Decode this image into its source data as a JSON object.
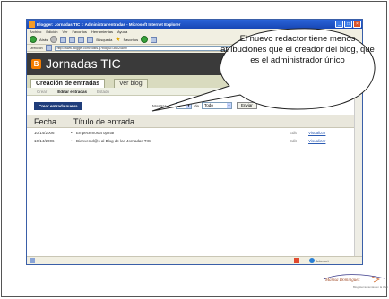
{
  "browser": {
    "window_title": "Blogger: Jornadas TIC :: Administrar entradas - Microsoft Internet Explorer",
    "menu": [
      "Archivo",
      "Edición",
      "Ver",
      "Favoritos",
      "Herramientas",
      "Ayuda"
    ],
    "toolbar": {
      "back": "Atrás",
      "search": "Búsqueda",
      "favorites": "Favoritos"
    },
    "address_label": "Dirección",
    "address_value": "http://www.blogger.com/posts.g?blogID=36024899",
    "status_zone": "Internet"
  },
  "blog": {
    "logo_letter": "B",
    "title": "Jornadas TIC",
    "tabs": {
      "active": "Creación de entradas",
      "inactive": "Ver blog"
    },
    "subtabs": [
      "Crear",
      "Editar entradas",
      "Estado"
    ],
    "new_post_button": "Crear entrada nueva",
    "filter": {
      "show_label": "Mostrar",
      "count_value": "5",
      "de_label": "de",
      "filter_value": "Todo",
      "send_button": "Enviar"
    },
    "columns": {
      "date": "Fecha",
      "title": "Título de entrada"
    },
    "posts": [
      {
        "date": "10/14/2006",
        "title": "Empecemos a opinar",
        "edit": "Edit",
        "view": "Visualizar"
      },
      {
        "date": "10/14/2006",
        "title": "Bienvenid@s al Blog de las Jornadas TIC",
        "edit": "Edit",
        "view": "Visualizar"
      }
    ]
  },
  "callout": {
    "text": "El nuevo redactor tiene menos atribuciones que el creador del blog, que es el administrador único"
  },
  "footer": {
    "name": "Marisa Dominguez",
    "subtitle": "Blog Herramientas en la Web"
  }
}
